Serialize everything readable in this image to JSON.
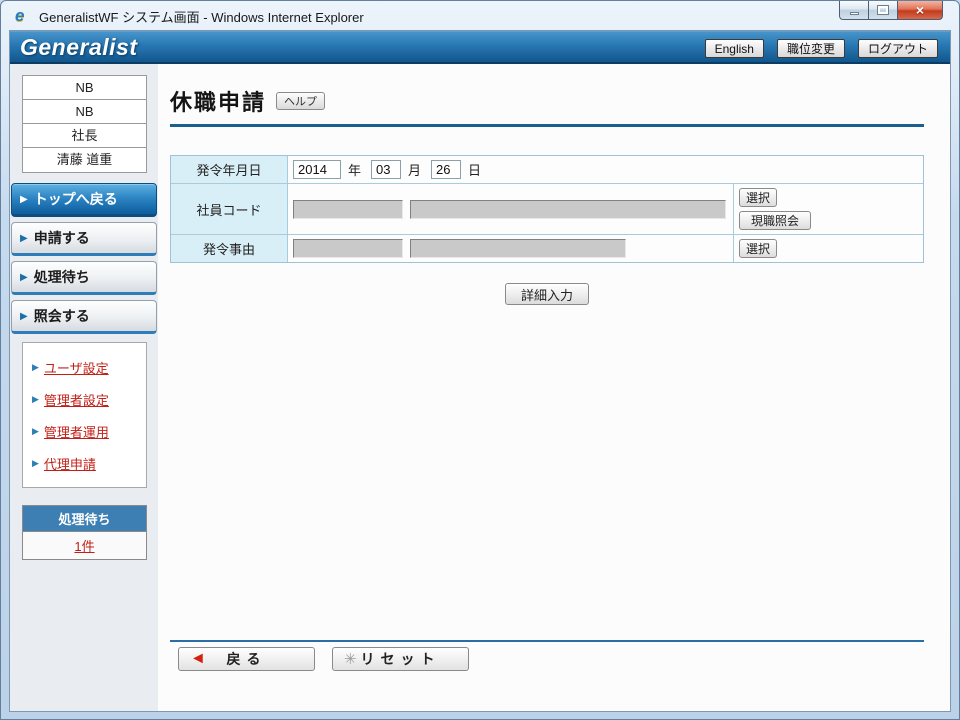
{
  "window": {
    "title": "GeneralistWF システム画面 - Windows Internet Explorer"
  },
  "header": {
    "logo": "Generalist",
    "english_button": "English",
    "position_change_button": "職位変更",
    "logout_button": "ログアウト"
  },
  "sidebar": {
    "user_info": [
      "NB",
      "NB",
      "社長",
      "清藤  道重"
    ],
    "menu": [
      {
        "label": "トップへ戻る",
        "active": true
      },
      {
        "label": "申請する",
        "active": false
      },
      {
        "label": "処理待ち",
        "active": false
      },
      {
        "label": "照会する",
        "active": false
      }
    ],
    "links": [
      "ユーザ設定",
      "管理者設定",
      "管理者運用",
      "代理申請"
    ],
    "pending": {
      "title": "処理待ち",
      "count": "1件"
    }
  },
  "main": {
    "title": "休職申請",
    "help_button": "ヘルプ",
    "form": {
      "issue_date": {
        "label": "発令年月日",
        "year_value": "2014",
        "year_unit": "年",
        "month_value": "03",
        "month_unit": "月",
        "day_value": "26",
        "day_unit": "日"
      },
      "employee_code": {
        "label": "社員コード",
        "select_button": "選択",
        "current_position_button": "現職照会"
      },
      "issue_reason": {
        "label": "発令事由",
        "select_button": "選択"
      }
    },
    "detail_input_button": "詳細入力",
    "footer": {
      "back_button": "戻る",
      "reset_button": "リセット"
    }
  },
  "icons": {
    "ie": "e",
    "menu_arrow": "▶",
    "back_arrow": "◄",
    "reset_spinner": "✳",
    "close": "×"
  },
  "colors": {
    "header_blue": "#2A7AB6",
    "active_menu_blue": "#1160A0",
    "label_cell_cyan": "#D9EFF7",
    "link_red": "#C22017",
    "rule_blue": "#19608F"
  }
}
